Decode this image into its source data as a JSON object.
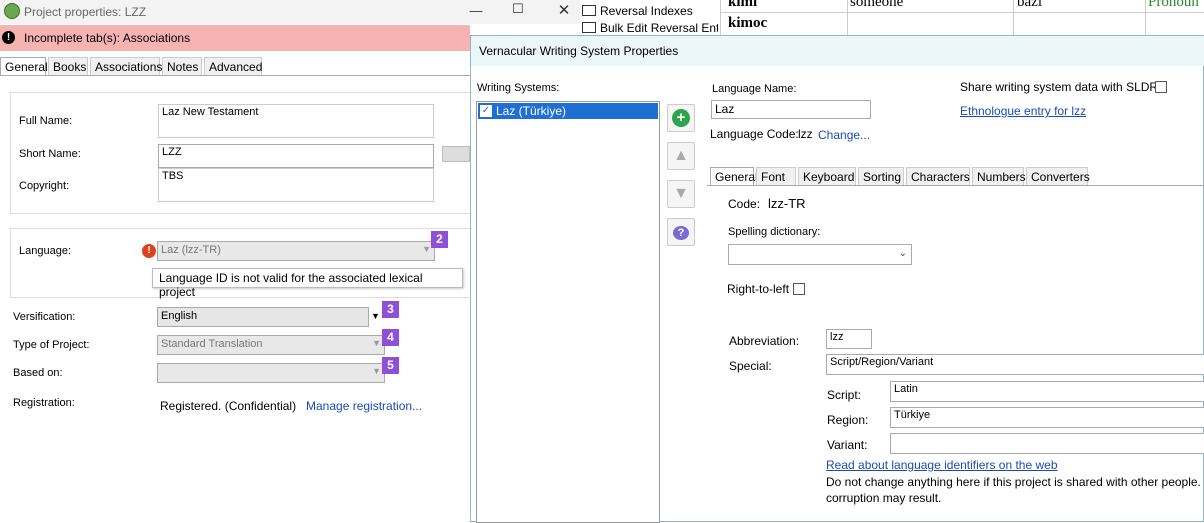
{
  "left_window": {
    "title": "Project properties: LZZ",
    "warning": "Incomplete tab(s): Associations",
    "tabs": [
      "General",
      "Books",
      "Associations",
      "Notes",
      "Advanced"
    ],
    "full_name_label": "Full Name:",
    "full_name_value": "Laz New Testament",
    "short_name_label": "Short Name:",
    "short_name_value": "LZZ",
    "copyright_label": "Copyright:",
    "copyright_value": "TBS",
    "language_label": "Language:",
    "language_value": "Laz (lzz-TR)",
    "language_badge": "2",
    "tooltip": "Language ID is not valid for the associated lexical project",
    "versification_label": "Versification:",
    "versification_value": "English",
    "versification_badge": "3",
    "type_label": "Type of Project:",
    "type_value": "Standard Translation",
    "type_badge": "4",
    "based_on_label": "Based on:",
    "based_on_badge": "5",
    "registration_label": "Registration:",
    "registration_value": "Registered. (Confidential)",
    "manage_link": "Manage registration..."
  },
  "background": {
    "menu_items": [
      "Reversal Indexes",
      "Bulk Edit Reversal Entries"
    ],
    "row1": [
      "kimi",
      "someone",
      "bazi",
      "Pronoun"
    ],
    "row2": [
      "kimoc"
    ]
  },
  "dialog": {
    "title": "Vernacular Writing System Properties",
    "ws_label": "Writing Systems:",
    "ws_items": [
      "Laz (Türkiye)"
    ],
    "lang_name_label": "Language Name:",
    "lang_name_value": "Laz",
    "lang_code_label": "Language Code:",
    "lang_code_value": "lzz",
    "change_link": "Change...",
    "share_label": "Share writing system data with SLDR",
    "ethnologue_link": "Ethnologue entry for lzz",
    "tabs": [
      "General",
      "Font",
      "Keyboard",
      "Sorting",
      "Characters",
      "Numbers",
      "Converters"
    ],
    "code_label": "Code:",
    "code_value": "lzz-TR",
    "spelling_label": "Spelling dictionary:",
    "rtl_label": "Right-to-left",
    "abbr_label": "Abbreviation:",
    "abbr_value": "lzz",
    "special_label": "Special:",
    "special_value": "Script/Region/Variant",
    "script_label": "Script:",
    "script_value": "Latin",
    "region_label": "Region:",
    "region_value": "Türkiye",
    "variant_label": "Variant:",
    "read_link": "Read about language identifiers on the web",
    "note_line1": "Do not change anything here if this project is shared with other people.",
    "note_line2": "corruption may result."
  }
}
